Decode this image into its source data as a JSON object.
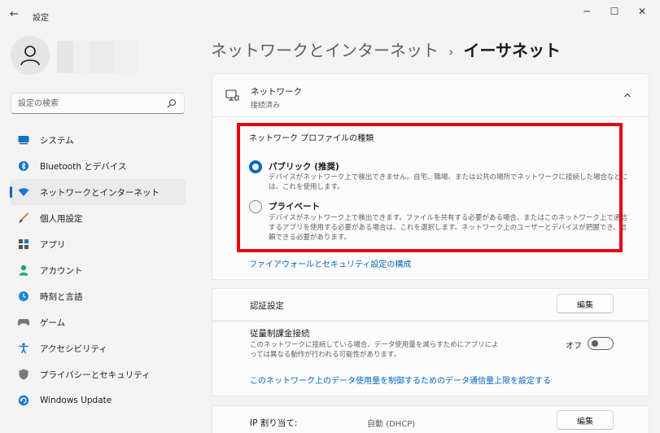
{
  "window": {
    "title": "設定",
    "back_icon": "back-arrow-icon",
    "minimize": "─",
    "maximize": "☐",
    "close": "✕"
  },
  "search": {
    "placeholder": "設定の検索"
  },
  "sidebar": {
    "items": [
      {
        "label": "システム",
        "icon": "monitor-icon",
        "active": false
      },
      {
        "label": "Bluetooth とデバイス",
        "icon": "bluetooth-icon",
        "active": false
      },
      {
        "label": "ネットワークとインターネット",
        "icon": "wifi-icon",
        "active": true
      },
      {
        "label": "個人用設定",
        "icon": "brush-icon",
        "active": false
      },
      {
        "label": "アプリ",
        "icon": "apps-icon",
        "active": false
      },
      {
        "label": "アカウント",
        "icon": "person-icon",
        "active": false
      },
      {
        "label": "時刻と言語",
        "icon": "globe-clock-icon",
        "active": false
      },
      {
        "label": "ゲーム",
        "icon": "gamepad-icon",
        "active": false
      },
      {
        "label": "アクセシビリティ",
        "icon": "accessibility-icon",
        "active": false
      },
      {
        "label": "プライバシーとセキュリティ",
        "icon": "shield-icon",
        "active": false
      },
      {
        "label": "Windows Update",
        "icon": "update-icon",
        "active": false
      }
    ]
  },
  "breadcrumb": {
    "parent": "ネットワークとインターネット",
    "separator": "›",
    "current": "イーサネット"
  },
  "network": {
    "title": "ネットワーク",
    "status": "接続済み"
  },
  "profile": {
    "heading": "ネットワーク プロファイルの種類",
    "public": {
      "title": "パブリック (推奨)",
      "desc": "デバイスがネットワーク上で検出できません。自宅、職場、または公共の場所でネットワークに接続した場合などには、これを使用します。",
      "selected": true
    },
    "private": {
      "title": "プライベート",
      "desc": "デバイスがネットワーク上で検出できます。ファイルを共有する必要がある場合、またはこのネットワーク上で通信するアプリを使用する必要がある場合は、これを選択します。ネットワーク上のユーザーとデバイスが把握でき、信頼できる必要があります。",
      "selected": false
    },
    "firewall_link": "ファイアウォールとセキュリティ設定の構成"
  },
  "auth": {
    "label": "認証設定",
    "edit": "編集"
  },
  "metered": {
    "label": "従量制課金接続",
    "desc": "このネットワークに接続している場合、データ使用量を減らすためにアプリによっては異なる動作が行われる可能性があります。",
    "toggle_label": "オフ",
    "toggle_on": false,
    "limit_link": "このネットワーク上のデータ使用量を制御するためのデータ通信量上限を設定する"
  },
  "ip": {
    "label": "IP 割り当て:",
    "value": "自動 (DHCP)",
    "edit": "編集"
  },
  "colors": {
    "accent": "#0067c0",
    "highlight": "#e60012"
  }
}
